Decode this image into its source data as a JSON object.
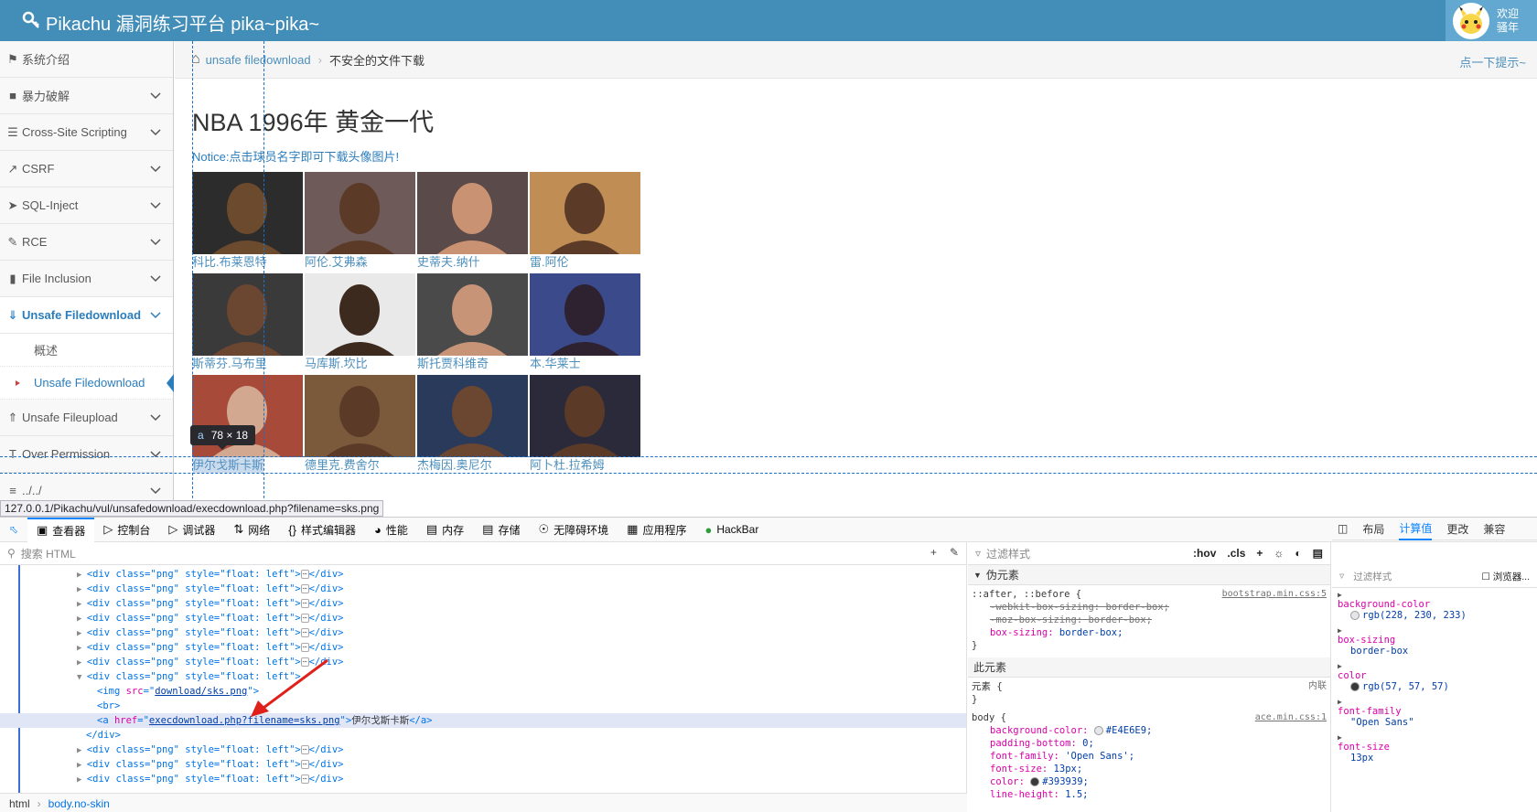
{
  "navbar": {
    "brand": "Pikachu 漏洞练习平台 pika~pika~",
    "welcome_line1": "欢迎",
    "welcome_line2": "骚年"
  },
  "sidebar": {
    "items": [
      {
        "label": "系统介绍",
        "icon": "tag-icon"
      },
      {
        "label": "暴力破解",
        "icon": "lock-icon"
      },
      {
        "label": "Cross-Site Scripting",
        "icon": "list-icon"
      },
      {
        "label": "CSRF",
        "icon": "share-icon"
      },
      {
        "label": "SQL-Inject",
        "icon": "fighter-jet-icon"
      },
      {
        "label": "RCE",
        "icon": "pencil-icon"
      },
      {
        "label": "File Inclusion",
        "icon": "file-icon"
      },
      {
        "label": "Unsafe Filedownload",
        "icon": "download-icon"
      },
      {
        "label": "Unsafe Fileupload",
        "icon": "upload-icon"
      },
      {
        "label": "Over Permission",
        "icon": "text-height-icon"
      },
      {
        "label": "../../",
        "icon": "align-justify-icon"
      }
    ],
    "subitems": [
      {
        "label": "概述"
      },
      {
        "label": "Unsafe Filedownload"
      }
    ]
  },
  "breadcrumb": {
    "home_link": "unsafe filedownload",
    "current": "不安全的文件下载",
    "hint": "点一下提示~"
  },
  "main": {
    "title": "NBA 1996年 黄金一代",
    "notice": "Notice:点击球员名字即可下载头像图片!",
    "players": [
      {
        "name": "科比.布莱恩特",
        "c": "#6b4a2d",
        "bg": "#2c2c2c"
      },
      {
        "name": "阿伦.艾弗森",
        "c": "#5b3a28",
        "bg": "#6e5a58"
      },
      {
        "name": "史蒂夫.纳什",
        "c": "#c99272",
        "bg": "#5a4a4a"
      },
      {
        "name": "雷.阿伦",
        "c": "#5b3a28",
        "bg": "#c08d55"
      },
      {
        "name": "斯蒂芬.马布里",
        "c": "#6b4630",
        "bg": "#3a3a3a"
      },
      {
        "name": "马库斯.坎比",
        "c": "#3d2a1e",
        "bg": "#e9e9e9"
      },
      {
        "name": "斯托贾科维奇",
        "c": "#c79478",
        "bg": "#4a4a4a"
      },
      {
        "name": "本.华莱士",
        "c": "#2e2230",
        "bg": "#3a4a8a"
      },
      {
        "name": "伊尔戈斯卡斯",
        "c": "#d2a890",
        "bg": "#a84a3a"
      },
      {
        "name": "德里克.费舍尔",
        "c": "#5b3a28",
        "bg": "#7a5a3a"
      },
      {
        "name": "杰梅因.奥尼尔",
        "c": "#6b4630",
        "bg": "#2a3a5a"
      },
      {
        "name": "阿卜杜.拉希姆",
        "c": "#5b3a28",
        "bg": "#2a2a3a"
      }
    ]
  },
  "inspector": {
    "tag": "a",
    "size": "78 × 18",
    "status_url": "127.0.0.1/Pikachu/vul/unsafedownload/execdownload.php?filename=sks.png"
  },
  "devtools": {
    "tabs": [
      "查看器",
      "控制台",
      "调试器",
      "网络",
      "样式编辑器",
      "性能",
      "内存",
      "存储",
      "无障碍环境",
      "应用程序",
      "HackBar"
    ],
    "search_placeholder": "搜索 HTML",
    "tree": {
      "collapsed_div": "<div class=\"png\" style=\"float: left\">",
      "open_div": "<div class=\"png\" style=\"float: left\">",
      "img_src": "download/sks.png",
      "a_href": "execdownload.php?filename=sks.png",
      "a_text": "伊尔戈斯卡斯",
      "close_div": "</div>"
    },
    "crumbs": [
      "html",
      "body.no-skin"
    ],
    "rules": {
      "filter": "过滤样式",
      "hov": ":hov",
      "cls": ".cls",
      "pseudo_section": "伪元素",
      "pseudo_selector": "::after, ::before",
      "pseudo_src": "bootstrap.min.css:5",
      "p1": "-webkit-box-sizing:",
      "p1v": "border-box;",
      "p2": "-moz-box-sizing:",
      "p2v": "border-box;",
      "p3": "box-sizing:",
      "p3v": "border-box;",
      "element_section": "此元素",
      "element_label": "元素",
      "element_src": "内联",
      "body_selector": "body",
      "body_src": "ace.min.css:1",
      "b1": "background-color:",
      "b1v": "#E4E6E9;",
      "b2": "padding-bottom:",
      "b2v": "0;",
      "b3": "font-family:",
      "b3v": "'Open Sans';",
      "b4": "font-size:",
      "b4v": "13px;",
      "b5": "color:",
      "b5v": "#393939;",
      "b6": "line-height:",
      "b6v": "1.5;"
    },
    "computed": {
      "tabs": [
        "布局",
        "计算值",
        "更改",
        "兼容"
      ],
      "filter": "过滤样式",
      "browser_label": "浏览器...",
      "props": [
        {
          "name": "background-color",
          "value": "rgb(228, 230, 233)"
        },
        {
          "name": "box-sizing",
          "value": "border-box"
        },
        {
          "name": "color",
          "value": "rgb(57, 57, 57)"
        },
        {
          "name": "font-family",
          "value": "\"Open Sans\""
        },
        {
          "name": "font-size",
          "value": "13px"
        }
      ]
    }
  },
  "colors": {
    "navbar": "#438eb9",
    "link": "#4c8fbd",
    "active": "#2b7dbc"
  }
}
